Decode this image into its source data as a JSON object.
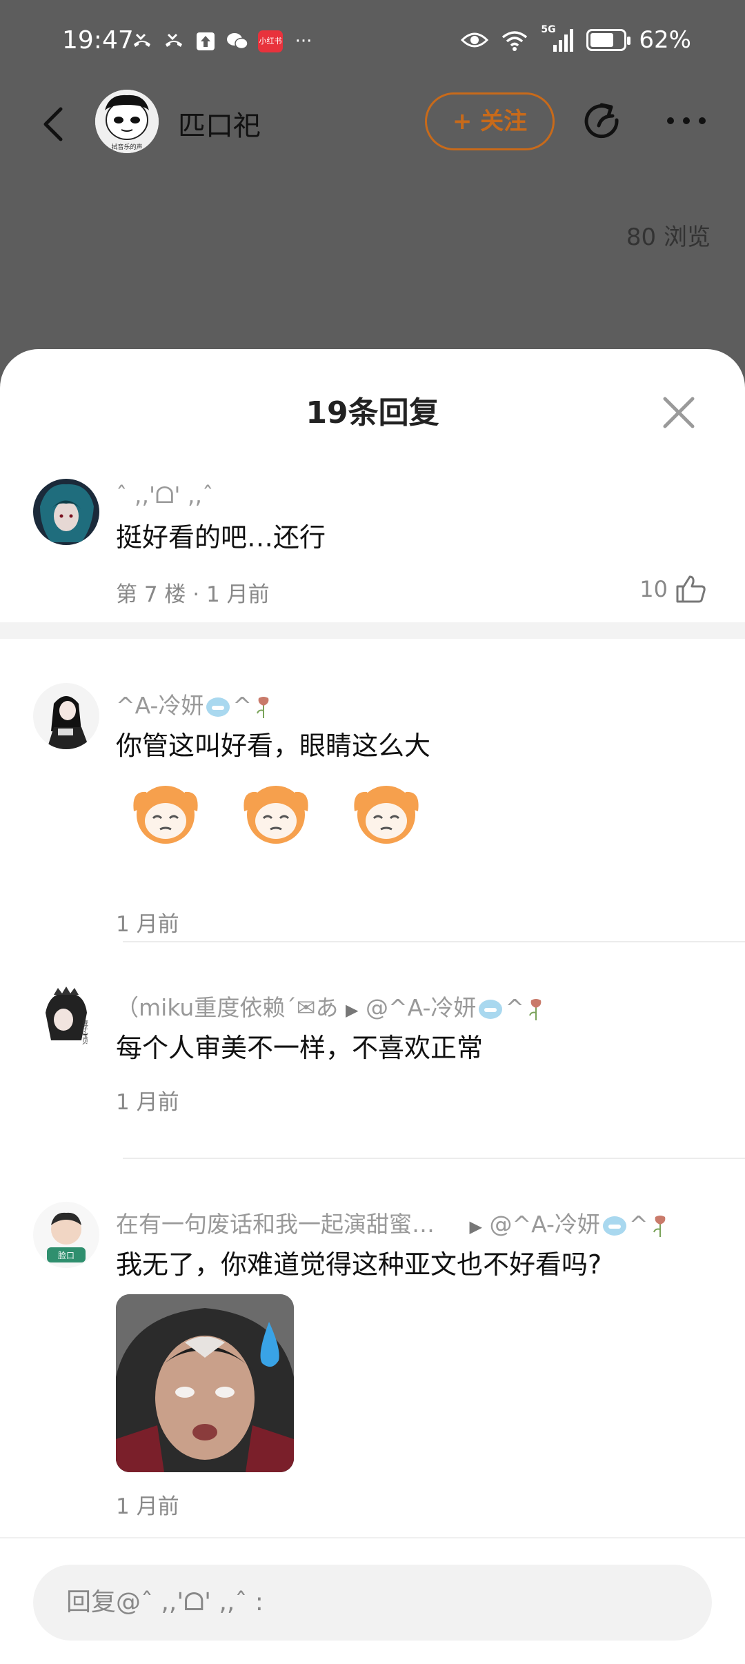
{
  "status_bar": {
    "time": "19:47",
    "app_badge": "小红书",
    "more_notifications": "···",
    "signal_label": "5G",
    "battery_percent": "62%",
    "battery_level": 0.62
  },
  "post": {
    "author_name": "匹口祀",
    "author_avatar_caption": "拭音乐的声",
    "follow_label": "+ 关注",
    "views": "80 浏览"
  },
  "sheet": {
    "title": "19条回复"
  },
  "main_comment": {
    "name": "ˆ ,,'ᗝ' ,,ˆ",
    "text": "挺好看的吧…还行",
    "floor": "第 7 楼",
    "separator": "·",
    "time": "1 月前",
    "likes": "10"
  },
  "replies": [
    {
      "name": "^A-冷妍",
      "name_suffix": "^",
      "text": "你管这叫好看，眼睛这么大",
      "time": "1 月前",
      "sticker_count": 3
    },
    {
      "name": "（miku重度依赖´✉あ",
      "arrow": "▶",
      "reply_to": "@^A-冷妍",
      "reply_to_suffix": "^",
      "avatar_caption": "壹子宝贝",
      "text": "每个人审美不一样，不喜欢正常",
      "time": "1 月前"
    },
    {
      "name": "在有一句废话和我一起演甜蜜…",
      "arrow": "▶",
      "reply_to": "@^A-冷妍",
      "reply_to_suffix": "^",
      "avatar_caption": "脸口",
      "text": "我无了，你难道觉得这种亚文也不好看吗?",
      "time": "1 月前"
    }
  ],
  "reply_box": {
    "placeholder": "回复@ˆ ,,'ᗝ' ,,ˆ :"
  },
  "colors": {
    "accent": "#c86a1a",
    "overlay": "#5d5d5d"
  }
}
